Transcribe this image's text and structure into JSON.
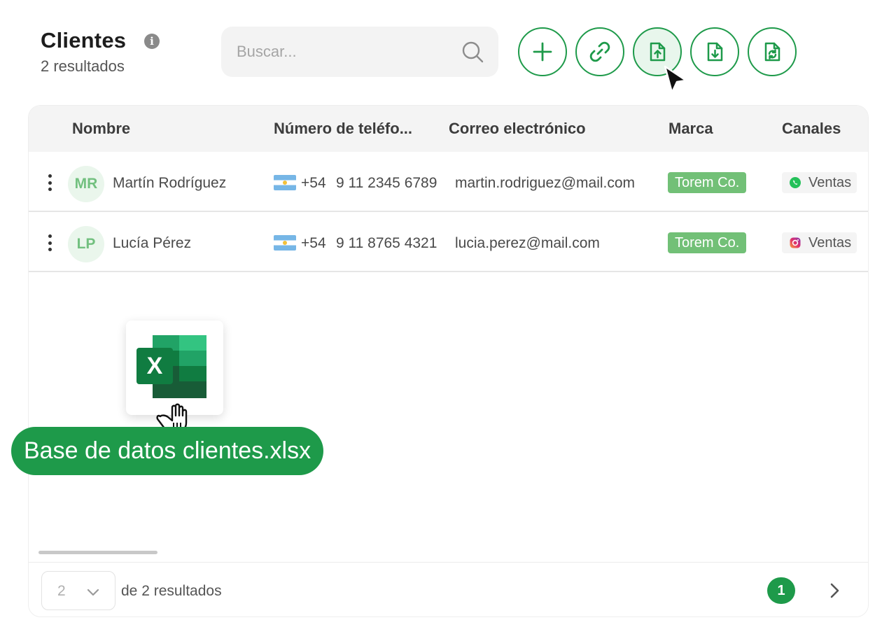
{
  "header": {
    "title": "Clientes",
    "subtitle": "2 resultados",
    "search_placeholder": "Buscar..."
  },
  "toolbar": {
    "buttons": [
      {
        "name": "add-button",
        "icon": "plus-icon"
      },
      {
        "name": "link-button",
        "icon": "link-icon"
      },
      {
        "name": "upload-button",
        "icon": "file-upload-icon",
        "active": true
      },
      {
        "name": "download-button",
        "icon": "file-download-icon"
      },
      {
        "name": "sync-button",
        "icon": "file-sync-icon"
      }
    ]
  },
  "table": {
    "columns": [
      "Nombre",
      "Número de teléfo...",
      "Correo electrónico",
      "Marca",
      "Canales"
    ],
    "rows": [
      {
        "initials": "MR",
        "name": "Martín Rodríguez",
        "country_code": "+54",
        "phone": "9 11 2345 6789",
        "email": "martin.rodriguez@mail.com",
        "brand": "Torem Co.",
        "channel": "Ventas",
        "channel_icon": "whatsapp-icon"
      },
      {
        "initials": "LP",
        "name": "Lucía Pérez",
        "country_code": "+54",
        "phone": "9 11 8765 4321",
        "email": "lucia.perez@mail.com",
        "brand": "Torem Co.",
        "channel": "Ventas",
        "channel_icon": "instagram-icon"
      }
    ]
  },
  "pagination": {
    "page_size": "2",
    "results_text": "de 2 resultados",
    "current_page": "1"
  },
  "drag": {
    "file_name": "Base de datos clientes.xlsx",
    "file_icon": "excel-icon",
    "file_icon_letter": "X"
  },
  "colors": {
    "accent": "#1e9a4a",
    "brand_badge": "#72c077",
    "avatar_bg": "#eaf6ec",
    "avatar_text": "#72c07f"
  }
}
